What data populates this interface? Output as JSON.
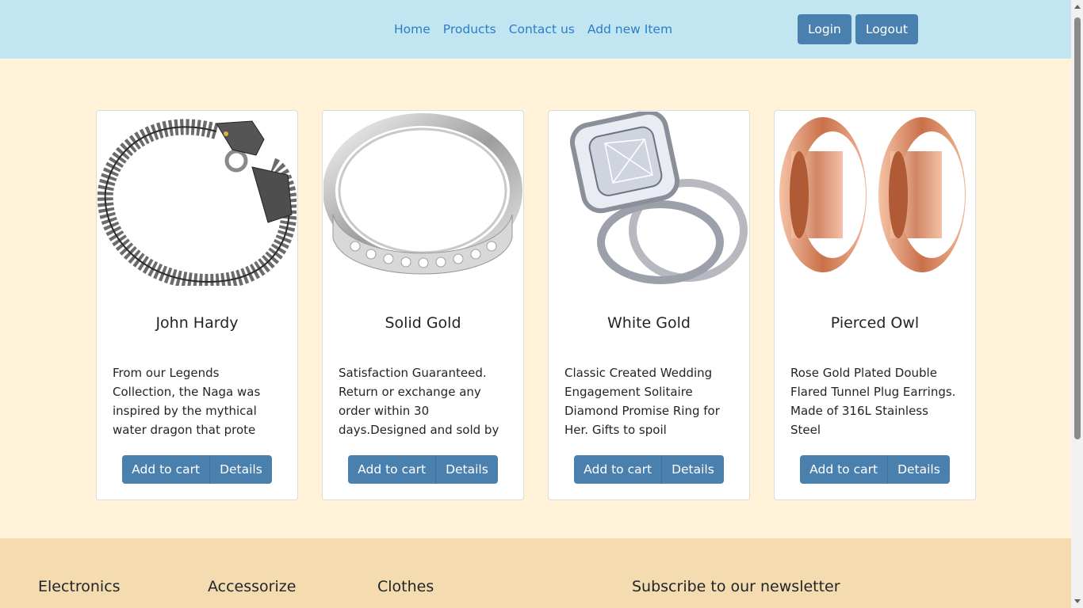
{
  "nav": {
    "links": [
      "Home",
      "Products",
      "Contact us",
      "Add new Item"
    ],
    "login_label": "Login",
    "logout_label": "Logout"
  },
  "products": [
    {
      "title": "John Hardy",
      "description": "From our Legends Collection, the Naga was inspired by the mythical water dragon that prote",
      "add_label": "Add to cart",
      "details_label": "Details",
      "image_icon": "dragon-bracelet-image"
    },
    {
      "title": "Solid Gold",
      "description": "Satisfaction Guaranteed. Return or exchange any order within 30 days.Designed and sold by",
      "add_label": "Add to cart",
      "details_label": "Details",
      "image_icon": "silver-ring-image"
    },
    {
      "title": "White Gold",
      "description": "Classic Created Wedding Engagement Solitaire Diamond Promise Ring for Her. Gifts to spoil",
      "add_label": "Add to cart",
      "details_label": "Details",
      "image_icon": "diamond-ring-image"
    },
    {
      "title": "Pierced Owl",
      "description": "Rose Gold Plated Double Flared Tunnel Plug Earrings. Made of 316L Stainless Steel",
      "add_label": "Add to cart",
      "details_label": "Details",
      "image_icon": "rose-gold-plugs-image"
    }
  ],
  "footer": {
    "columns": [
      "Electronics",
      "Accessorize",
      "Clothes",
      "Subscribe to our newsletter"
    ]
  },
  "colors": {
    "navbar_bg": "#c1e5f1",
    "page_bg": "#fff2d9",
    "footer_bg": "#f4dcb0",
    "button_bg": "#4a80ad",
    "link": "#2c7ec9"
  }
}
